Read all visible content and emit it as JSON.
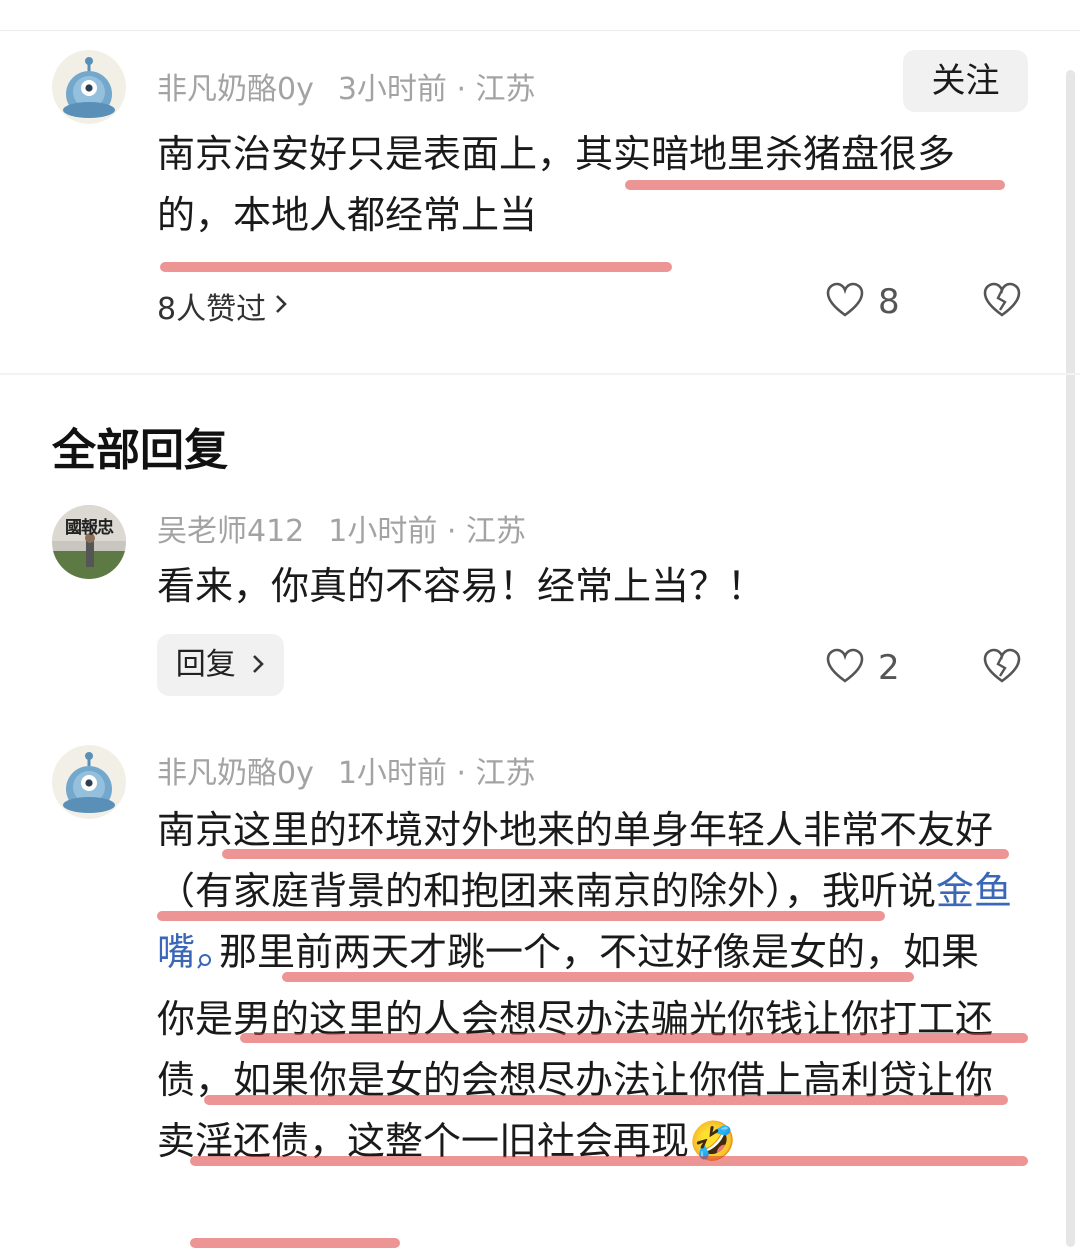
{
  "comment": {
    "username": "非凡奶酪0y",
    "time": "3小时前",
    "location": "· 江苏",
    "follow_label": "关注",
    "text": "南京治安好只是表面上，其实暗地里杀猪盘很多的，本地人都经常上当",
    "liked_by": "8人赞过",
    "like_count": "8"
  },
  "replies_section": {
    "title": "全部回复"
  },
  "replies": [
    {
      "username": "吴老师412",
      "time": "1小时前",
      "location": "· 江苏",
      "avatar_text": "國報忠",
      "text": "看来，你真的不容易！经常上当？！",
      "reply_label": "回复",
      "like_count": "2"
    },
    {
      "username": "非凡奶酪0y",
      "time": "1小时前",
      "location": "· 江苏",
      "text_before_link": "南京这里的环境对外地来的单身年轻人非常不友好（有家庭背景的和抱团来南京的除外），我听说",
      "link_text": "金鱼嘴",
      "text_after_link": "那里前两天才跳一个，不过好像是女的，如果你是男的这里的人会想尽办法骗光你钱让你打工还债，如果你是女的会想尽办法让你借上高利贷让你卖淫还债，这整个一旧社会再现",
      "emoji": "🤣"
    }
  ],
  "icons": [
    "avatar-alien-icon",
    "heart-icon",
    "broken-heart-icon",
    "chevron-right-icon",
    "search-icon"
  ],
  "colors": {
    "link": "#3a68b7",
    "underline": "#de3c3c",
    "meta": "#a3a3a3"
  }
}
